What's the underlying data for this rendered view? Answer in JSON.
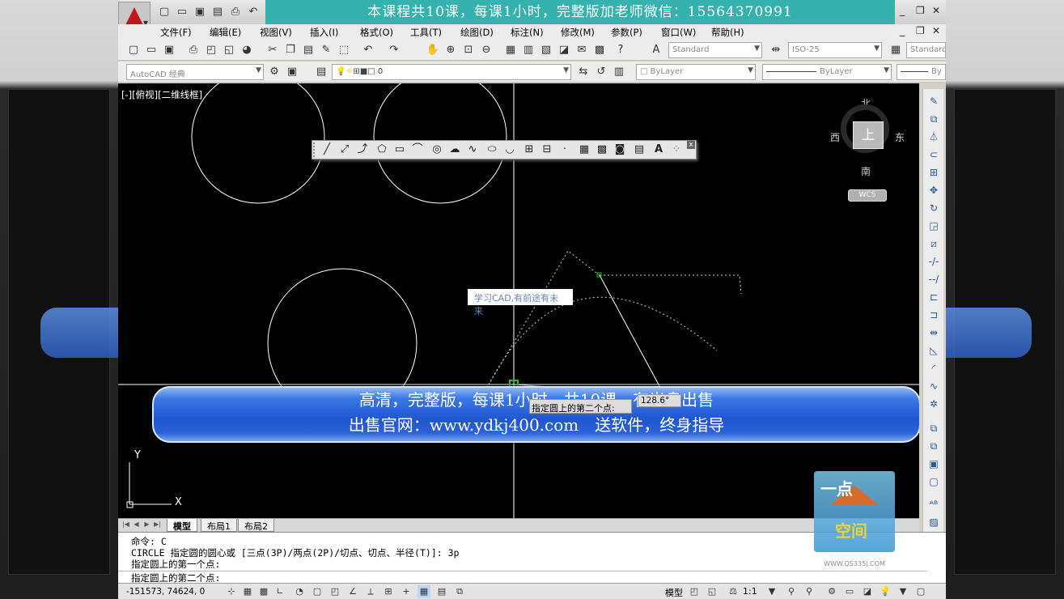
{
  "promo_top": "本课程共10课，每课1小时，完整版加老师微信：15564370991",
  "window_controls": [
    "_",
    "❐",
    "✕"
  ],
  "menus": [
    "文件(F)",
    "编辑(E)",
    "视图(V)",
    "插入(I)",
    "格式(O)",
    "工具(T)",
    "绘图(D)",
    "标注(N)",
    "修改(M)",
    "参数(P)",
    "窗口(W)",
    "帮助(H)"
  ],
  "toolbar": {
    "text_style": "Standard",
    "dim_style": "ISO-25",
    "table_style": "Standard",
    "workspace": "AutoCAD 经典",
    "layer": "0",
    "color": "ByLayer",
    "linetype": "ByLayer",
    "lineweight": "By"
  },
  "canvas": {
    "view_label": "[-][俯视][二维线框]",
    "dyn_tip": "学习CAD,有前途有未来",
    "prompt_tip": "指定圆上的第二个点:",
    "angle_tip": "128.6°"
  },
  "compass": {
    "north": "北",
    "south": "南",
    "east": "东",
    "west": "西",
    "face": "上",
    "wcs": "WCS"
  },
  "ucs": {
    "x": "X",
    "y": "Y"
  },
  "promo_band": {
    "line1": "高清，完整版，每课1小时，共10课，有光盘出售",
    "line2": "出售官网：www.ydkj400.com　送软件，终身指导"
  },
  "layout_tabs": [
    "模型",
    "布局1",
    "布局2"
  ],
  "command_lines": [
    "命令: C",
    "CIRCLE 指定圆的圆心或 [三点(3P)/两点(2P)/切点、切点、半径(T)]: 3p",
    "指定圆上的第一个点:"
  ],
  "command_current": "指定圆上的第二个点:",
  "status": {
    "coords": "-151573, 74624, 0",
    "model": "模型",
    "scale": "1:1"
  },
  "watermark": {
    "line1": "一点",
    "line2": "空间",
    "url": "WWW.QS335J.COM"
  }
}
